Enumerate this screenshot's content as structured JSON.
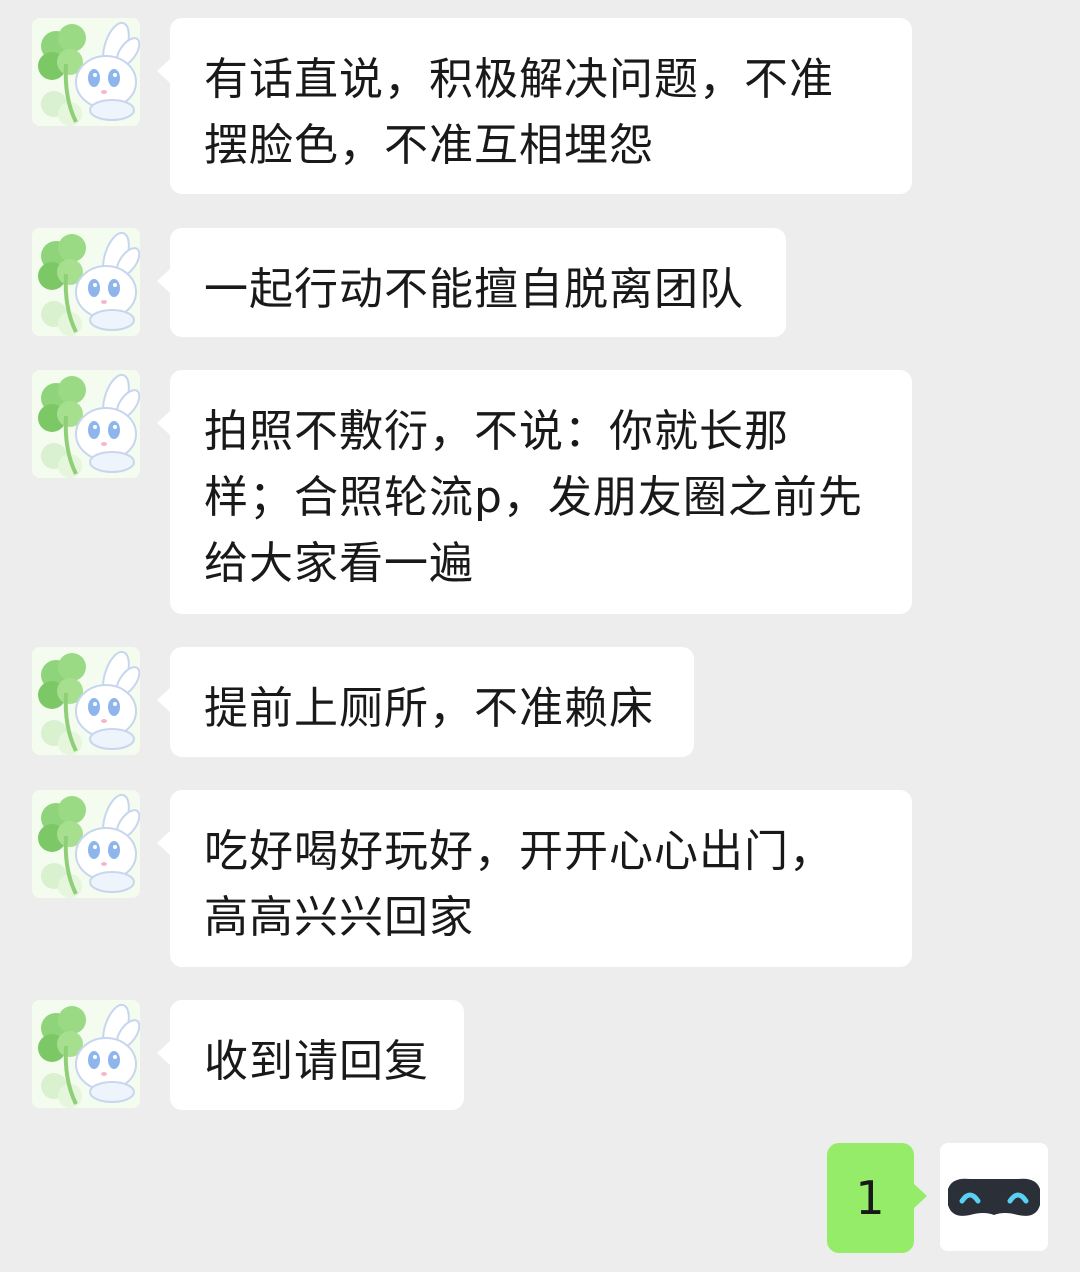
{
  "chat": {
    "messages": [
      {
        "sender": "other",
        "text": "有话直说，积极解决问题，不准摆脸色，不准互相埋怨"
      },
      {
        "sender": "other",
        "text": "一起行动不能擅自脱离团队"
      },
      {
        "sender": "other",
        "text": "拍照不敷衍，不说：你就长那样；合照轮流p，发朋友圈之前先给大家看一遍"
      },
      {
        "sender": "other",
        "text": "提前上厕所，不准赖床"
      },
      {
        "sender": "other",
        "text": "吃好喝好玩好，开开心心出门，高高兴兴回家"
      },
      {
        "sender": "other",
        "text": "收到请回复"
      },
      {
        "sender": "self",
        "text": "1"
      }
    ]
  },
  "avatars": {
    "other_icon": "clover-bunny-avatar-icon",
    "self_icon": "mask-avatar-icon"
  },
  "colors": {
    "background": "#ededed",
    "bubble_other": "#ffffff",
    "bubble_self": "#95ec69",
    "text": "#191919"
  }
}
